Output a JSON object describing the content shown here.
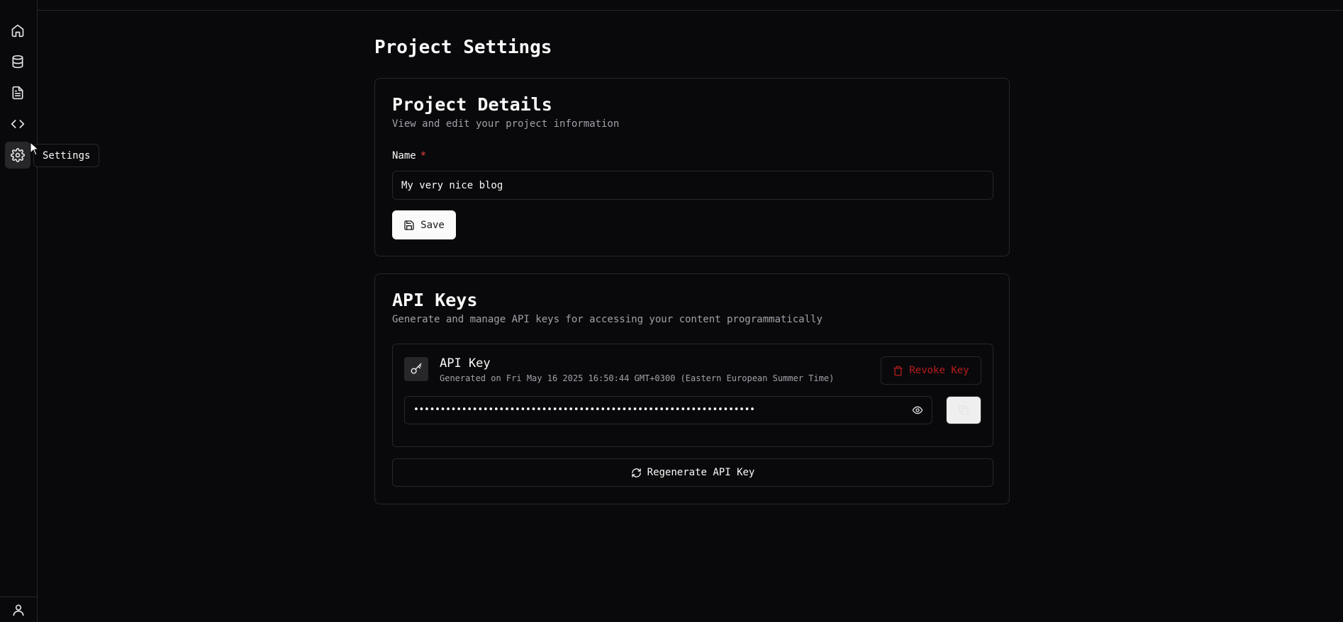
{
  "sidebar": {
    "items": [
      {
        "name": "home",
        "icon": "home-icon",
        "active": false
      },
      {
        "name": "database",
        "icon": "database-icon",
        "active": false
      },
      {
        "name": "documents",
        "icon": "file-text-icon",
        "active": false
      },
      {
        "name": "code",
        "icon": "code-icon",
        "active": false
      },
      {
        "name": "settings",
        "icon": "gear-icon",
        "active": true
      }
    ],
    "footer_icon": "user-icon",
    "tooltip": "Settings"
  },
  "page": {
    "title": "Project Settings"
  },
  "project_details": {
    "title": "Project Details",
    "description": "View and edit your project information",
    "name_label": "Name",
    "required_marker": "*",
    "name_value": "My very nice blog",
    "save_label": "Save"
  },
  "api_keys": {
    "title": "API Keys",
    "description": "Generate and manage API keys for accessing your content programmatically",
    "key": {
      "title": "API Key",
      "generated": "Generated on Fri May 16 2025 16:50:44 GMT+0300 (Eastern European Summer Time)",
      "masked_value": "••••••••••••••••••••••••••••••••••••••••••••••••••••••••••••••••",
      "revoke_label": "Revoke Key"
    },
    "regenerate_label": "Regenerate API Key"
  },
  "colors": {
    "background": "#09090b",
    "border": "#27272a",
    "danger": "#b91c1c",
    "required": "#ef4444",
    "muted_text": "#a1a1aa"
  }
}
